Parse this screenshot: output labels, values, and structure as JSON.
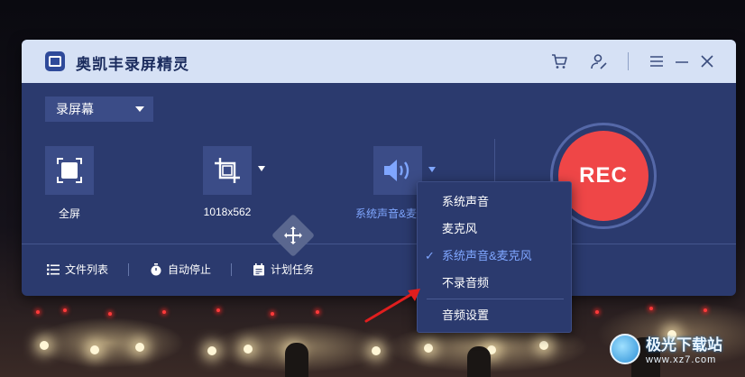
{
  "app": {
    "title": "奥凯丰录屏精灵"
  },
  "titlebar": {
    "icons": [
      "cart-icon",
      "user-edit-icon",
      "menu-icon",
      "minimize-icon",
      "close-icon"
    ]
  },
  "mode_select": {
    "value": "录屏幕"
  },
  "capture": {
    "fullscreen_label": "全屏",
    "region_label": "1018x562",
    "audio_label": "系统声音&麦"
  },
  "rec_button": {
    "label": "REC",
    "color": "#ef4647"
  },
  "bottom_bar": {
    "file_list": "文件列表",
    "auto_stop": "自动停止",
    "schedule": "计划任务"
  },
  "audio_menu": {
    "items": [
      {
        "label": "系统声音",
        "selected": false
      },
      {
        "label": "麦克风",
        "selected": false
      },
      {
        "label": "系统声音&麦克风",
        "selected": true
      },
      {
        "label": "不录音频",
        "selected": false
      },
      {
        "label": "音频设置",
        "selected": false
      }
    ],
    "selected_color": "#7fa6ff"
  },
  "watermark": {
    "name": "极光下载站",
    "url": "www.xz7.com"
  },
  "colors": {
    "window_bg": "#2b3a6e",
    "titlebar_bg": "#d6e1f5",
    "accent": "#ef4647"
  }
}
